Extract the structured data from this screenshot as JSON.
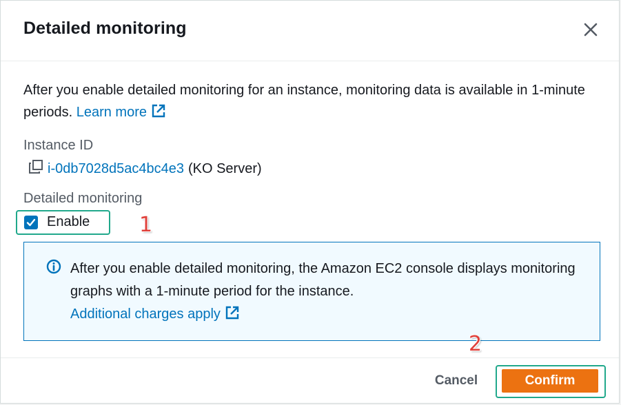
{
  "modal": {
    "title": "Detailed monitoring",
    "close_icon": "close-icon"
  },
  "description": {
    "text": "After you enable detailed monitoring for an instance, monitoring data is available in 1-minute periods.",
    "link_text": "Learn more",
    "link_icon": "external-link-icon"
  },
  "instance": {
    "label": "Instance ID",
    "id": "i-0db7028d5ac4bc4e3",
    "name": "(KO Server)",
    "copy_icon": "copy-icon"
  },
  "monitoring": {
    "label": "Detailed monitoring",
    "checkbox_label": "Enable",
    "checked": true
  },
  "annotations": {
    "step1": "1",
    "step2": "2",
    "highlight_color": "#20a88b",
    "number_color": "#e0403a"
  },
  "info": {
    "icon": "info-icon",
    "text": "After you enable detailed monitoring, the Amazon EC2 console displays monitoring graphs with a 1-minute period for the instance.",
    "link_text": "Additional charges apply",
    "link_icon": "external-link-icon"
  },
  "footer": {
    "cancel_label": "Cancel",
    "confirm_label": "Confirm"
  },
  "colors": {
    "link": "#0073bb",
    "primary_button": "#ec7211",
    "info_background": "#f1faff"
  }
}
